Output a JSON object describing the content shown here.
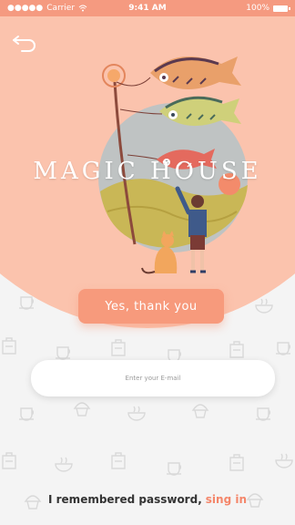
{
  "status_bar": {
    "carrier": "Carrier",
    "time": "9:41 AM",
    "battery": "100%"
  },
  "hero": {
    "brand_title": "MAGIC HOUSE"
  },
  "actions": {
    "confirm_label": "Yes, thank you"
  },
  "form": {
    "email_placeholder": "Enter your E-mail"
  },
  "footer": {
    "prefix": "I remembered password,",
    "link": "sing in"
  },
  "colors": {
    "accent": "#f79a7c",
    "hero_bg": "#fbc3ad",
    "status_bar": "#f59a80",
    "link": "#f4866a"
  },
  "icons": [
    "back-arrow-icon",
    "wifi-icon",
    "battery-icon",
    "cup-icon",
    "bowl-icon",
    "bag-icon",
    "cupcake-icon"
  ]
}
